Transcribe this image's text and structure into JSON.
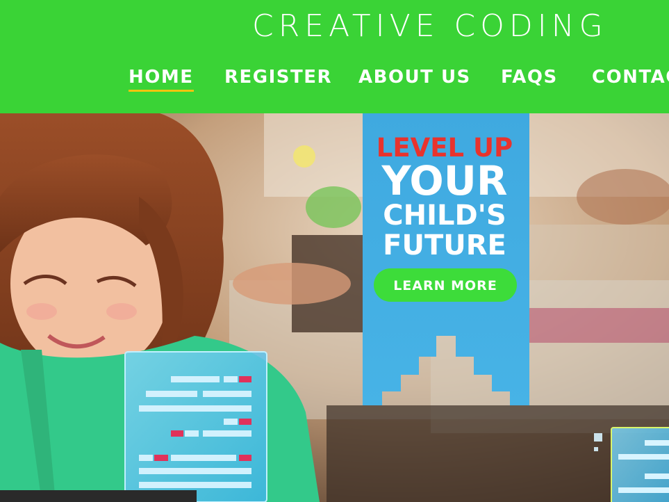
{
  "header": {
    "title": "CREATIVE CODING",
    "nav": [
      {
        "label": "HOME",
        "active": true
      },
      {
        "label": "REGISTER",
        "active": false
      },
      {
        "label": "ABOUT US",
        "active": false
      },
      {
        "label": "FAQS",
        "active": false
      },
      {
        "label": "CONTAC",
        "active": false
      }
    ]
  },
  "hero": {
    "banner": {
      "line1": "LEVEL UP",
      "line2": "YOUR",
      "line3": "CHILD'S",
      "line4": "FUTURE",
      "cta_label": "LEARN MORE"
    }
  },
  "colors": {
    "brand_green": "#3ad336",
    "nav_underline": "#f1c40f",
    "banner_blue": "#3fa9e0",
    "accent_red": "#e8332d",
    "cta_green": "#3ddc3a"
  }
}
